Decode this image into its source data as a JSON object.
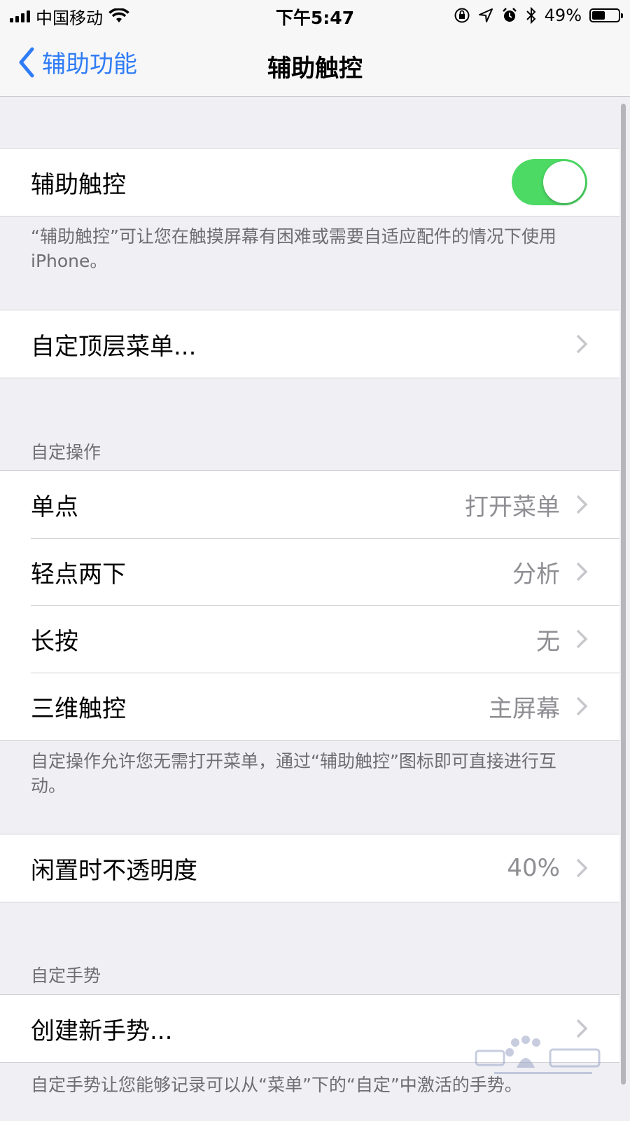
{
  "status_bar": {
    "carrier": "中国移动",
    "time": "下午5:47",
    "battery": "49%",
    "battery_level": 0.49,
    "icons": [
      "signal-icon",
      "wifi-icon",
      "orientation-lock-icon",
      "location-icon",
      "alarm-icon",
      "bluetooth-icon",
      "battery-icon"
    ]
  },
  "nav": {
    "back_label": "辅助功能",
    "title": "辅助触控"
  },
  "assistive_touch": {
    "label": "辅助触控",
    "enabled": true,
    "footer": "“辅助触控”可让您在触摸屏幕有困难或需要自适应配件的情况下使用 iPhone。"
  },
  "top_menu": {
    "label": "自定顶层菜单..."
  },
  "custom_actions": {
    "header": "自定操作",
    "rows": [
      {
        "label": "单点",
        "value": "打开菜单"
      },
      {
        "label": "轻点两下",
        "value": "分析"
      },
      {
        "label": "长按",
        "value": "无"
      },
      {
        "label": "三维触控",
        "value": "主屏幕"
      }
    ],
    "footer": "自定操作允许您无需打开菜单，通过“辅助触控”图标即可直接进行互动。"
  },
  "idle_opacity": {
    "label": "闲置时不透明度",
    "value": "40%"
  },
  "custom_gestures": {
    "header": "自定手势",
    "create_label": "创建新手势...",
    "footer": "自定手势让您能够记录可以从“菜单”下的“自定”中激活的手势。"
  },
  "colors": {
    "accent": "#2f7cf6",
    "toggle_on": "#4cd964",
    "background": "#efeff4",
    "secondary_text": "#8e8e93"
  }
}
